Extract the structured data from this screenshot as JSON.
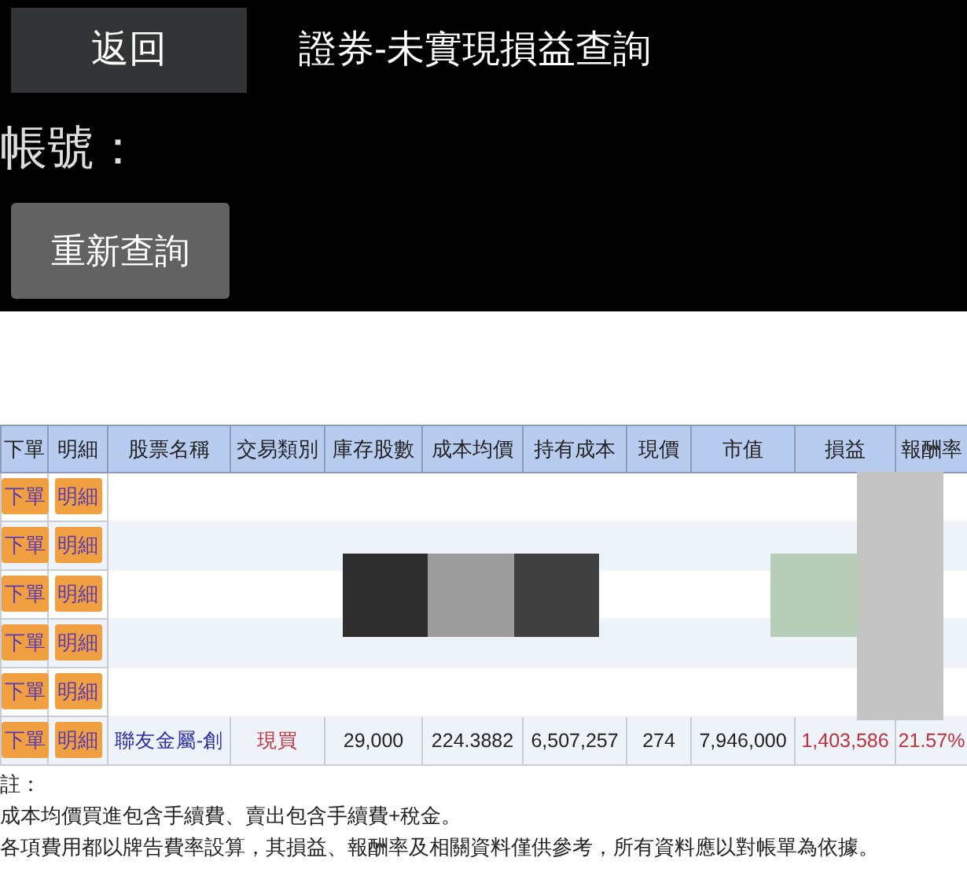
{
  "header": {
    "back_button": "返回",
    "title": "證券-未實現損益查詢"
  },
  "account": {
    "label": "帳號："
  },
  "requery_button": "重新查詢",
  "table": {
    "columns": [
      "下單",
      "明細",
      "股票名稱",
      "交易類別",
      "庫存股數",
      "成本均價",
      "持有成本",
      "現價",
      "市值",
      "損益",
      "報酬率"
    ],
    "rows": [
      {
        "kind": "hidden",
        "order": "下單",
        "detail": "明細"
      },
      {
        "kind": "hidden",
        "order": "下單",
        "detail": "明細"
      },
      {
        "kind": "hidden",
        "order": "下單",
        "detail": "明細"
      },
      {
        "kind": "hidden",
        "order": "下單",
        "detail": "明細"
      },
      {
        "kind": "hidden",
        "order": "下單",
        "detail": "明細"
      },
      {
        "kind": "full",
        "order": "下單",
        "detail": "明細",
        "name": "聯友金屬-創",
        "type": "現買",
        "shares": "29,000",
        "avg_cost": "224.3882",
        "cost": "6,507,257",
        "price": "274",
        "value": "7,946,000",
        "pnl": "1,403,586",
        "rate": "21.57%"
      }
    ]
  },
  "notes": [
    "註：",
    "成本均價買進包含手續費、賣出包含手續費+稅金。",
    "各項費用都以牌告費率設算，其損益、報酬率及相關資料僅供參考，所有資料應以對帳單為依據。"
  ]
}
